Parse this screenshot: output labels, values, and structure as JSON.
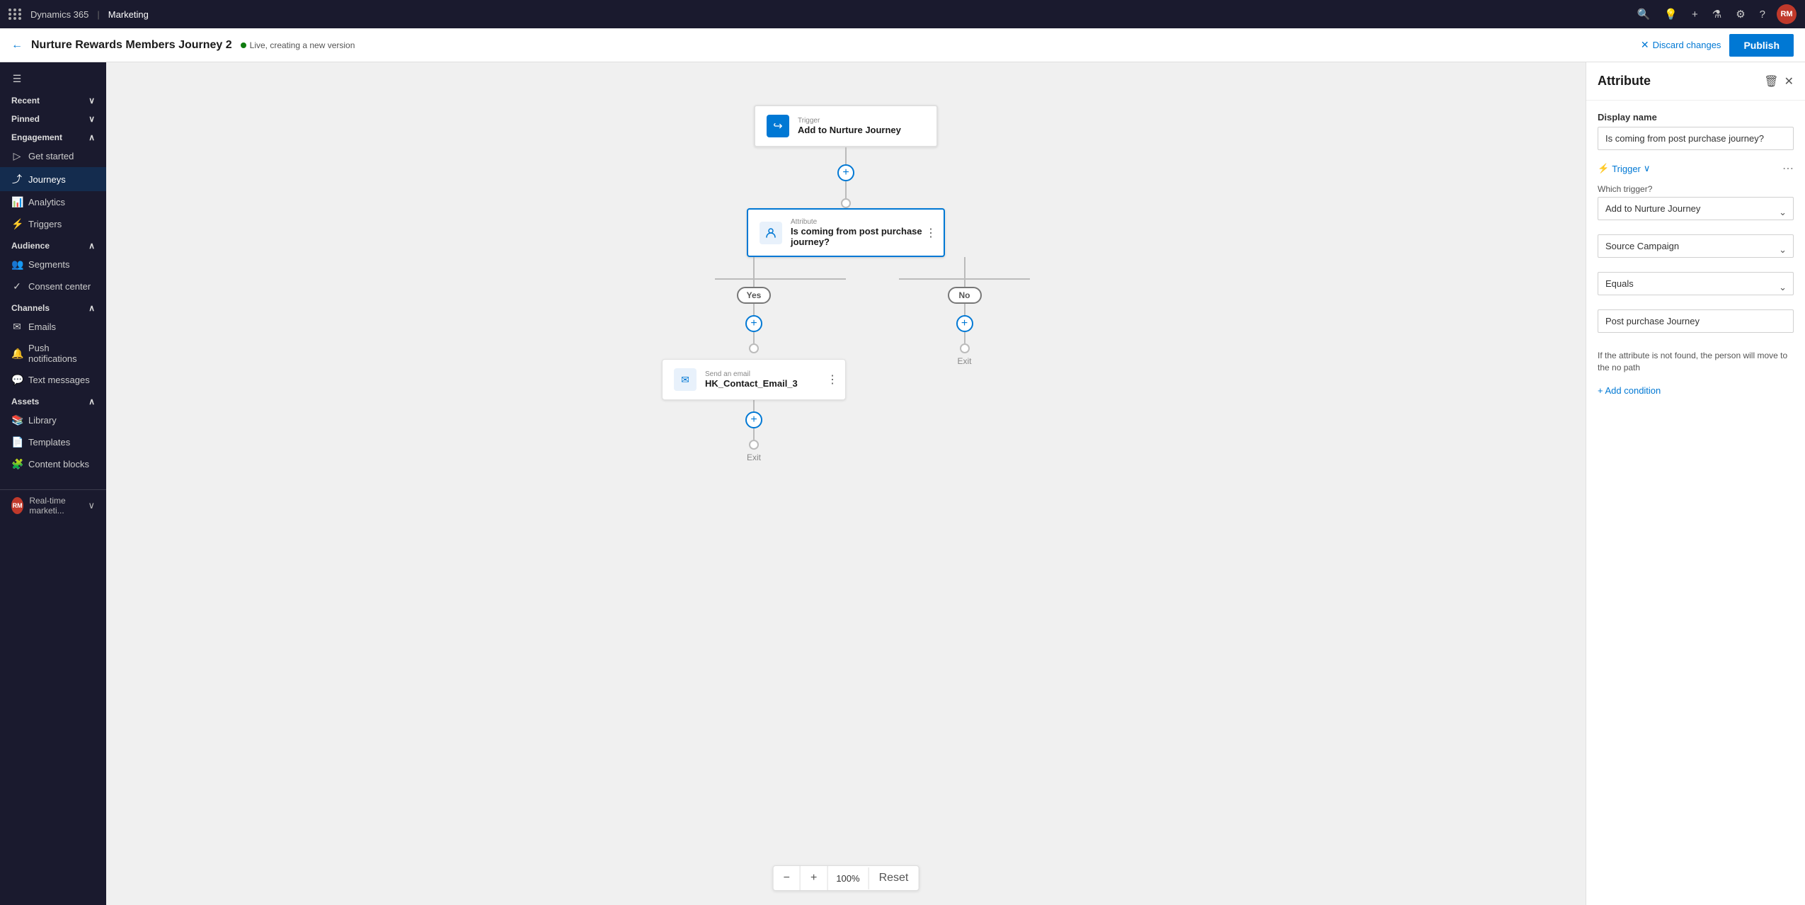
{
  "topbar": {
    "brand": "Dynamics 365",
    "app": "Marketing",
    "avatar_initials": "RM"
  },
  "secondbar": {
    "journey_title": "Nurture Rewards Members Journey 2",
    "status_text": "Live, creating a new version",
    "discard_label": "Discard changes",
    "publish_label": "Publish"
  },
  "sidebar": {
    "hamburger": "☰",
    "sections": [
      {
        "label": "Recent",
        "icon": "▷",
        "expandable": true
      },
      {
        "label": "Pinned",
        "icon": "📌",
        "expandable": true
      }
    ],
    "engagement_label": "Engagement",
    "items_engagement": [
      {
        "label": "Get started",
        "icon": "▷"
      },
      {
        "label": "Journeys",
        "icon": "⤴",
        "active": true
      },
      {
        "label": "Analytics",
        "icon": "📊"
      },
      {
        "label": "Triggers",
        "icon": "⚡"
      }
    ],
    "audience_label": "Audience",
    "items_audience": [
      {
        "label": "Segments",
        "icon": "👥"
      },
      {
        "label": "Consent center",
        "icon": "✓"
      }
    ],
    "channels_label": "Channels",
    "items_channels": [
      {
        "label": "Emails",
        "icon": "✉"
      },
      {
        "label": "Push notifications",
        "icon": "🔔"
      },
      {
        "label": "Text messages",
        "icon": "💬"
      }
    ],
    "assets_label": "Assets",
    "items_assets": [
      {
        "label": "Library",
        "icon": "📚"
      },
      {
        "label": "Templates",
        "icon": "📄"
      },
      {
        "label": "Content blocks",
        "icon": "🧩"
      }
    ],
    "bottom_label": "Real-time marketi...",
    "bottom_avatar": "RM"
  },
  "canvas": {
    "trigger_node": {
      "label_small": "Trigger",
      "label_main": "Add to Nurture Journey"
    },
    "attribute_node": {
      "label_small": "Attribute",
      "label_main": "Is coming from post purchase journey?"
    },
    "yes_label": "Yes",
    "no_label": "No",
    "email_node": {
      "label_small": "Send an email",
      "label_main": "HK_Contact_Email_3"
    },
    "exit_label": "Exit",
    "exit_label2": "Exit",
    "zoom_pct": "100%",
    "zoom_reset": "Reset"
  },
  "right_panel": {
    "title": "Attribute",
    "display_name_label": "Display name",
    "display_name_value": "Is coming from post purchase journey?",
    "trigger_section_label": "Trigger",
    "which_trigger_label": "Which trigger?",
    "which_trigger_value": "Add to Nurture Journey",
    "source_campaign_value": "Source Campaign",
    "equals_value": "Equals",
    "post_purchase_value": "Post purchase Journey",
    "note_text": "If the attribute is not found, the person will move to the no path",
    "add_condition_label": "+ Add condition"
  }
}
